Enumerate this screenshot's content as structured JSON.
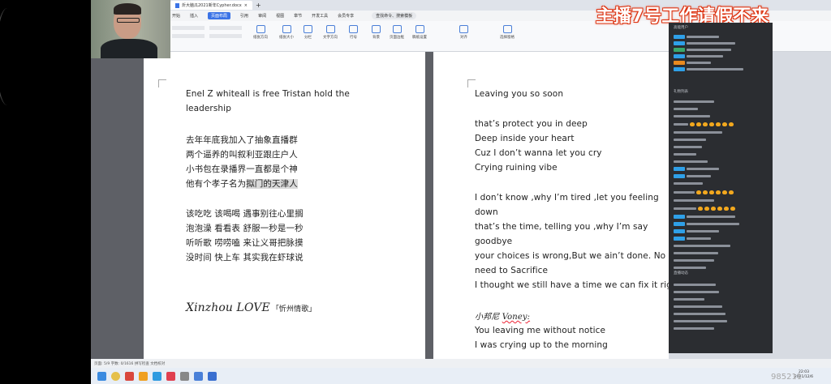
{
  "banner": {
    "text": "主播7号工作请假不来"
  },
  "watermark": {
    "text": "985211"
  },
  "doc_tab": {
    "title": "炘大脑瓜2021新年Cypher.docx"
  },
  "menu": {
    "items": [
      "开始",
      "插入",
      "页面布局",
      "引用",
      "审阅",
      "视图",
      "章节",
      "开发工具",
      "会员专享",
      "查找命令、搜索模板"
    ],
    "active_index": 2
  },
  "ribbon": {
    "buttons": [
      "纸张方向",
      "纸张大小",
      "分栏",
      "文字方向",
      "行号",
      "背景",
      "页面边框",
      "稿纸设置",
      "对齐",
      "选择窗格"
    ]
  },
  "page_left": {
    "lines": [
      "Enel Z   whiteall is   free   Tristan hold the",
      "leadership",
      "去年年底我加入了抽象直播群",
      "两个逼养的叫叙利亚跟庄户人",
      "小书包在录播界一直都是个神",
      "他有个孝子名为",
      "拟门的天津人",
      "该吃吃  该喝喝  遇事别往心里搁",
      "泡泡澡  看看表  舒服一秒是一秒",
      "听听歌  唠唠嗑  来让义哥把脉摸",
      "没时间  快上车  其实我在虾球说",
      "Xinzhou LOVE",
      "「忻州情歌」"
    ]
  },
  "page_right": {
    "lines": [
      "Leaving you so soon",
      "that’s protect you in deep",
      "Deep inside your heart",
      "Cuz I don’t wanna let you cry",
      "Crying ruining vibe",
      "I don’t know ,why I’m tired ,let you feeling",
      "down",
      "that’s the time, telling you ,why I’m say",
      "goodbye",
      "your choices is wrong,But we ain’t done. No",
      "need to Sacrifice",
      "I thought we still have a time we can fix it right",
      "小邦尼",
      "Voney:",
      "You leaving me without notice",
      "I was crying up to the morning"
    ]
  },
  "statusbar": {
    "text": "页面: 5/9   字数: 0/1616   拼写检查   文档校对"
  },
  "clock": {
    "time": "22:03",
    "date": "2021/12/6"
  },
  "chat": {
    "sections": [
      "高能用户",
      "礼物列表",
      "直播动态"
    ]
  }
}
